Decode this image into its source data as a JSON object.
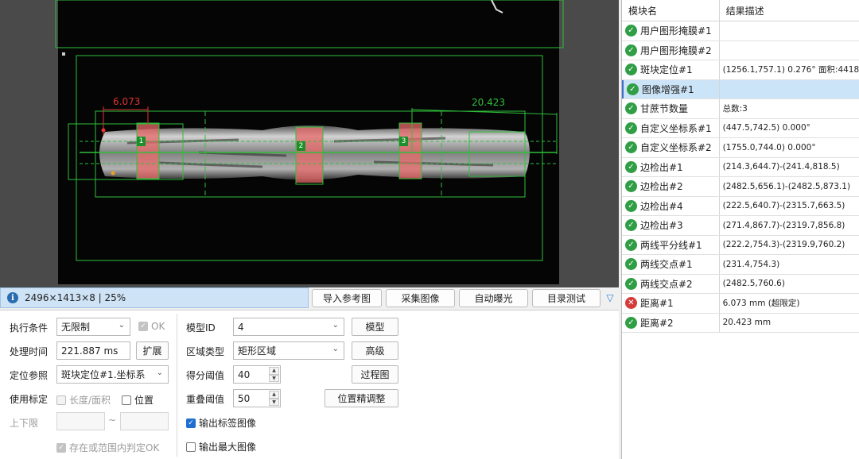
{
  "status": {
    "text": "2496×1413×8 | 25%"
  },
  "toolbar": {
    "import_ref": "导入参考图",
    "capture": "采集图像",
    "auto_exposure": "自动曝光",
    "dir_test": "目录测试"
  },
  "viewer": {
    "blob_labels": [
      "1",
      "2",
      "3"
    ],
    "measure_left": "6.073",
    "measure_right": "20.423"
  },
  "params": {
    "exec_cond_label": "执行条件",
    "exec_cond_value": "无限制",
    "ok_label": "OK",
    "proc_time_label": "处理时间",
    "proc_time_value": "221.887 ms",
    "expand_label": "扩展",
    "pos_ref_label": "定位参照",
    "pos_ref_value": "斑块定位#1.坐标系",
    "use_calib_label": "使用标定",
    "len_area_label": "长度/面积",
    "position_label": "位置",
    "range_label": "上下限",
    "range_sep": "~",
    "in_range_label": "存在或范围内判定OK",
    "model_id_label": "模型ID",
    "model_id_value": "4",
    "model_btn": "模型",
    "region_type_label": "区域类型",
    "region_type_value": "矩形区域",
    "advanced_btn": "高级",
    "score_label": "得分阈值",
    "score_value": "40",
    "process_img_btn": "过程图",
    "overlap_label": "重叠阈值",
    "overlap_value": "50",
    "pos_fine_btn": "位置精调整",
    "output_label_img": "输出标签图像",
    "output_max_img": "输出最大图像"
  },
  "results": {
    "col_module": "模块名",
    "col_desc": "结果描述",
    "rows": [
      {
        "name": "用户图形掩膜#1",
        "desc": "",
        "ok": true
      },
      {
        "name": "用户图形掩膜#2",
        "desc": "",
        "ok": true
      },
      {
        "name": "斑块定位#1",
        "desc": "(1256.1,757.1) 0.276° 面积:4418",
        "ok": true
      },
      {
        "name": "图像增强#1",
        "desc": "",
        "ok": true,
        "selected": true
      },
      {
        "name": "甘蔗节数量",
        "desc": "总数:3",
        "ok": true
      },
      {
        "name": "自定义坐标系#1",
        "desc": "(447.5,742.5) 0.000°",
        "ok": true
      },
      {
        "name": "自定义坐标系#2",
        "desc": "(1755.0,744.0) 0.000°",
        "ok": true
      },
      {
        "name": "边检出#1",
        "desc": "(214.3,644.7)-(241.4,818.5)",
        "ok": true
      },
      {
        "name": "边检出#2",
        "desc": "(2482.5,656.1)-(2482.5,873.1)",
        "ok": true
      },
      {
        "name": "边检出#4",
        "desc": "(222.5,640.7)-(2315.7,663.5)",
        "ok": true
      },
      {
        "name": "边检出#3",
        "desc": "(271.4,867.7)-(2319.7,856.8)",
        "ok": true
      },
      {
        "name": "两线平分线#1",
        "desc": "(222.2,754.3)-(2319.9,760.2)",
        "ok": true
      },
      {
        "name": "两线交点#1",
        "desc": "(231.4,754.3)",
        "ok": true
      },
      {
        "name": "两线交点#2",
        "desc": "(2482.5,760.6)",
        "ok": true
      },
      {
        "name": "距离#1",
        "desc": "6.073 mm (超限定)",
        "ok": false
      },
      {
        "name": "距离#2",
        "desc": "20.423 mm",
        "ok": true
      }
    ]
  },
  "colors": {
    "overlay_green": "#2fbf3a",
    "node_fill": "#e86a6a",
    "measure_red": "#d33",
    "ok": "#2f9e44",
    "ng": "#d63b3b"
  }
}
